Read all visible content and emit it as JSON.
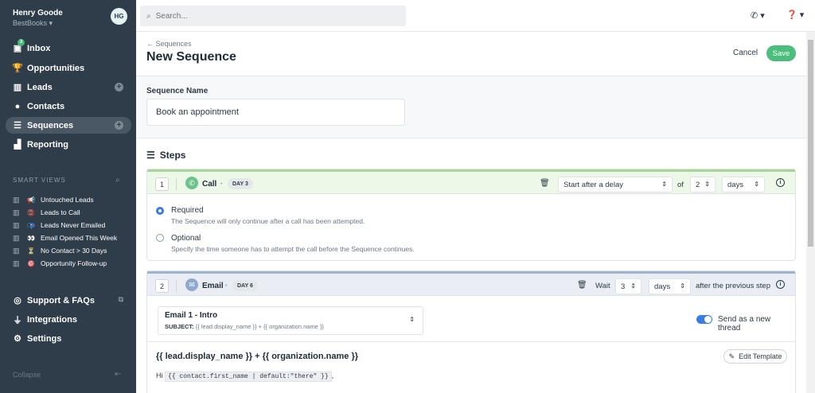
{
  "user": {
    "name": "Henry Goode",
    "org": "BestBooks",
    "initials": "HG"
  },
  "nav": [
    {
      "label": "Inbox",
      "badge": "3"
    },
    {
      "label": "Opportunities"
    },
    {
      "label": "Leads"
    },
    {
      "label": "Contacts"
    },
    {
      "label": "Sequences"
    },
    {
      "label": "Reporting"
    }
  ],
  "smart_views": {
    "title": "SMART VIEWS",
    "items": [
      {
        "emoji": "📢",
        "label": "Untouched Leads"
      },
      {
        "emoji": "📵",
        "label": "Leads to Call"
      },
      {
        "emoji": "📭",
        "label": "Leads Never Emailed"
      },
      {
        "emoji": "👀",
        "label": "Email Opened This Week"
      },
      {
        "emoji": "⏳",
        "label": "No Contact > 30 Days"
      },
      {
        "emoji": "🎯",
        "label": "Opportunity Follow-up"
      }
    ]
  },
  "bottom_nav": [
    {
      "label": "Support & FAQs"
    },
    {
      "label": "Integrations"
    },
    {
      "label": "Settings"
    }
  ],
  "collapse_label": "Collapse",
  "search": {
    "placeholder": "Search..."
  },
  "header": {
    "breadcrumb": "Sequences",
    "title": "New Sequence",
    "cancel": "Cancel",
    "save": "Save"
  },
  "sequence_name": {
    "label": "Sequence Name",
    "value": "Book an appointment"
  },
  "steps_title": "Steps",
  "step1": {
    "number": "1",
    "type": "Call",
    "day": "DAY 3",
    "delay_select": "Start after a delay",
    "of_label": "of",
    "delay_value": "2",
    "unit": "days",
    "options": [
      {
        "title": "Required",
        "desc": "The Sequence will only continue after a call has been attempted."
      },
      {
        "title": "Optional",
        "desc": "Specify the time someone has to attempt the call before the Sequence continues."
      }
    ]
  },
  "step2": {
    "number": "2",
    "type": "Email",
    "day": "DAY 6",
    "wait_label": "Wait",
    "wait_value": "3",
    "unit": "days",
    "after_label": "after the previous step",
    "template_name": "Email 1 - Intro",
    "subject_label": "SUBJECT:",
    "subject_value": "{{ lead.display_name }} + {{ organization.name }}",
    "thread_label": "Send as a new thread",
    "subject_heading": "{{ lead.display_name }} + {{ organization.name }}",
    "edit_template": "Edit Template",
    "body_hi": "Hi",
    "body_code": "{{ contact.first_name | default:\"there\" }}",
    "body_after": ","
  }
}
